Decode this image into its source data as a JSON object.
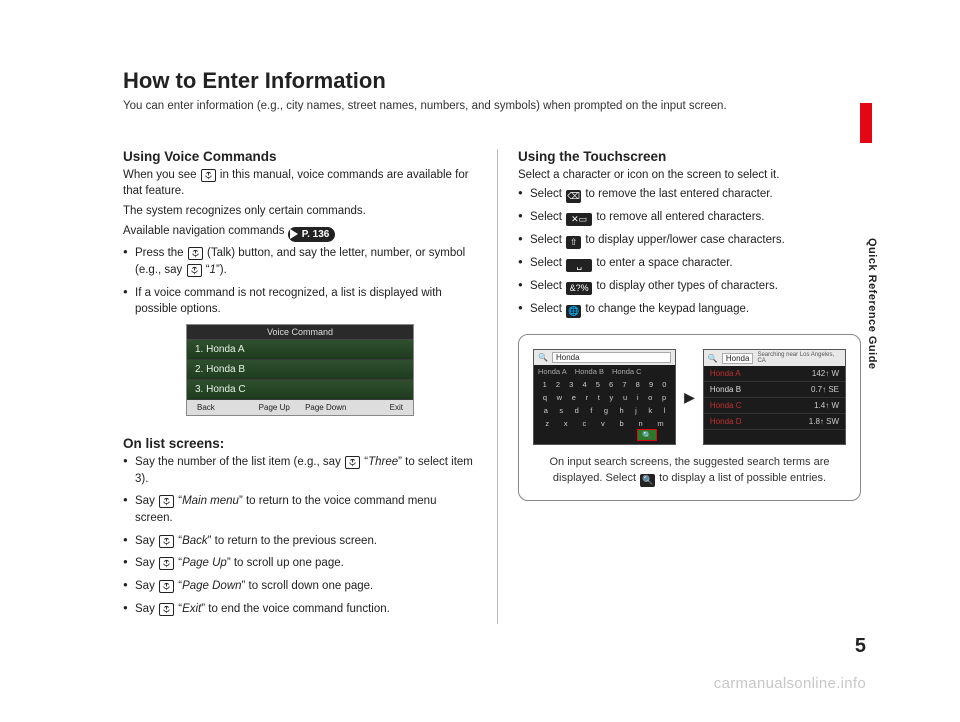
{
  "side_label": "Quick Reference Guide",
  "page_number": "5",
  "watermark": "carmanualsonline.info",
  "title": "How to Enter Information",
  "intro": "You can enter information (e.g., city names, street names, numbers, and symbols) when prompted on the input screen.",
  "voice": {
    "heading": "Using Voice Commands",
    "p1_a": "When you see ",
    "p1_b": " in this manual, voice commands are available for that feature.",
    "p2": "The system recognizes only certain commands.",
    "p3_a": "Available navigation commands ",
    "plink": "P. 136",
    "b1_a": "Press the ",
    "b1_b": " (Talk) button, and say the letter, number, or symbol (e.g., say ",
    "b1_c": " “",
    "b1_cmd": "1",
    "b1_d": "”).",
    "b2": "If a voice command is not recognized, a list is displayed with possible options.",
    "mock": {
      "header": "Voice Command",
      "items": [
        "1. Honda A",
        "2. Honda B",
        "3. Honda C"
      ],
      "footer": [
        "Back",
        "Page Up",
        "Page Down",
        "Exit"
      ]
    },
    "list_heading": "On list screens:",
    "l1_a": "Say the number of the list item (e.g., say ",
    "l1_b": " “",
    "l1_cmd": "Three",
    "l1_c": "” to select item 3).",
    "l2_a": "Say ",
    "l2_b": " “",
    "l2_cmd": "Main menu",
    "l2_c": "” to return to the voice command menu screen.",
    "l3_a": "Say ",
    "l3_cmd": "Back",
    "l3_c": "” to return to the previous screen.",
    "l4_cmd": "Page Up",
    "l4_c": "” to scroll up one page.",
    "l5_cmd": "Page Down",
    "l5_c": "” to scroll down one page.",
    "l6_cmd": "Exit",
    "l6_c": "” to end the voice command function."
  },
  "touch": {
    "heading": "Using the Touchscreen",
    "intro": "Select a character or icon on the screen to select it.",
    "items": [
      {
        "icon": "⌫",
        "cls": "icon-dark",
        "text": " to remove the last entered character."
      },
      {
        "icon": "✕▭",
        "cls": "icon-dark icon-wide",
        "text": " to remove all entered characters."
      },
      {
        "icon": "⇧",
        "cls": "icon-dark",
        "text": " to display upper/lower case characters."
      },
      {
        "icon": "␣",
        "cls": "icon-dark icon-wide",
        "text": " to enter a space character."
      },
      {
        "icon": "&?%",
        "cls": "icon-dark icon-wide",
        "text": " to display other types of characters."
      },
      {
        "icon": "🌐",
        "cls": "icon-dark",
        "text": " to change the keypad language."
      }
    ],
    "select_prefix": "Select ",
    "screen1": {
      "field": "Honda",
      "tabs": [
        "Honda A",
        "Honda B",
        "Honda C"
      ],
      "kb": [
        [
          "1",
          "2",
          "3",
          "4",
          "5",
          "6",
          "7",
          "8",
          "9",
          "0"
        ],
        [
          "q",
          "w",
          "e",
          "r",
          "t",
          "y",
          "u",
          "i",
          "o",
          "p"
        ],
        [
          "a",
          "s",
          "d",
          "f",
          "g",
          "h",
          "j",
          "k",
          "l"
        ],
        [
          "z",
          "x",
          "c",
          "v",
          "b",
          "n",
          "m"
        ]
      ]
    },
    "screen2": {
      "field": "Honda",
      "hint": "Searching near Los Angeles, CA",
      "results": [
        {
          "name": "Honda A",
          "dist": "142↑",
          "dir": "W"
        },
        {
          "name": "Honda B",
          "dist": "0.7↑",
          "dir": "SE"
        },
        {
          "name": "Honda C",
          "dist": "1.4↑",
          "dir": "W"
        },
        {
          "name": "Honda D",
          "dist": "1.8↑",
          "dir": "SW"
        }
      ]
    },
    "caption_a": "On input search screens, the suggested search terms are displayed. Select ",
    "caption_b": " to display a list of possible entries."
  }
}
